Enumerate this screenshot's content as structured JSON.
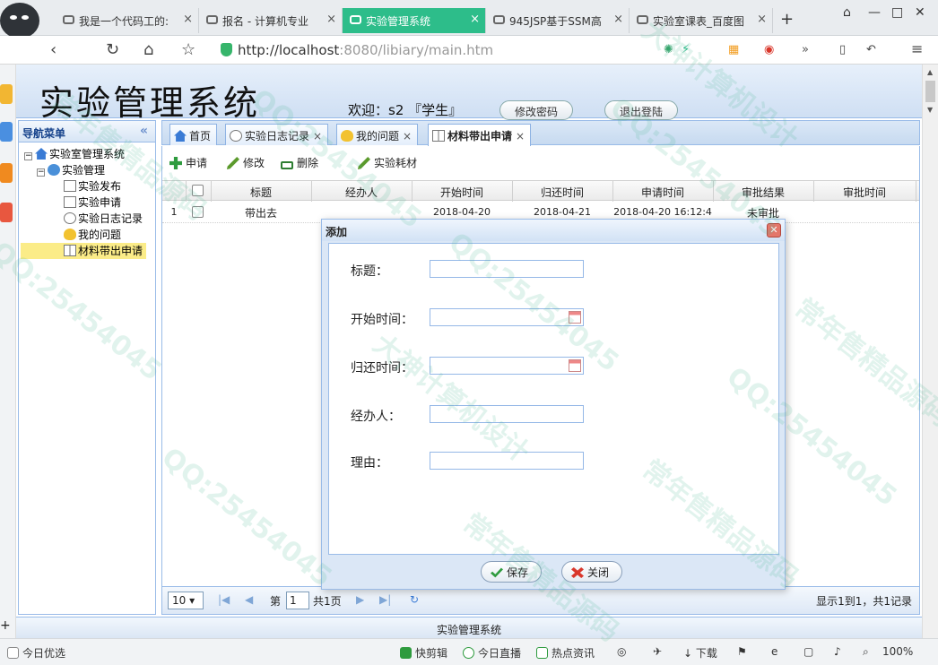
{
  "browser": {
    "tabs": [
      {
        "title": "我是一个代码工的:",
        "active": false
      },
      {
        "title": "报名 - 计算机专业",
        "active": false
      },
      {
        "title": "实验管理系统",
        "active": true
      },
      {
        "title": "945JSP基于SSM高",
        "active": false
      },
      {
        "title": "实验室课表_百度图",
        "active": false
      }
    ],
    "url_host": "http://localhost",
    "url_rest": ":8080/libiary/main.htm",
    "status": {
      "left": "今日优选",
      "items": [
        "快剪辑",
        "今日直播",
        "热点资讯",
        "下载"
      ],
      "zoom": "100%"
    }
  },
  "app": {
    "title": "实验管理系统",
    "welcome": "欢迎：s2 『学生』",
    "change_password": "修改密码",
    "logout": "退出登陆",
    "footer": "实验管理系统"
  },
  "nav": {
    "heading": "导航菜单",
    "root": "实验室管理系统",
    "group": "实验管理",
    "items": [
      "实验发布",
      "实验申请",
      "实验日志记录",
      "我的问题",
      "材料带出申请"
    ]
  },
  "content_tabs": [
    "首页",
    "实验日志记录",
    "我的问题",
    "材料带出申请"
  ],
  "toolbar": {
    "apply": "申请",
    "edit": "修改",
    "delete": "删除",
    "consume": "实验耗材"
  },
  "table": {
    "columns": [
      "标题",
      "经办人",
      "开始时间",
      "归还时间",
      "申请时间",
      "审批结果",
      "审批时间"
    ],
    "rows": [
      {
        "index": "1",
        "title": "带出去",
        "handler": "",
        "start": "2018-04-20",
        "return": "2018-04-21",
        "applied": "2018-04-20 16:12:4",
        "result": "未审批",
        "approved": ""
      }
    ]
  },
  "pager": {
    "page_size": "10",
    "page_prefix": "第",
    "page": "1",
    "page_total": "共1页",
    "info": "显示1到1，共1记录"
  },
  "dialog": {
    "title": "添加",
    "fields": {
      "title": "标题：",
      "start": "开始时间：",
      "return": "归还时间：",
      "handler": "经办人：",
      "reason": "理由："
    },
    "save": "保存",
    "close": "关闭"
  },
  "watermark": {
    "qq": "QQ:25454045",
    "a": "大神计算机设计",
    "b": "常年售精品源码"
  },
  "icons": {
    "nav_collapse": "double-chevron-left-icon",
    "calendar": "calendar-icon"
  }
}
